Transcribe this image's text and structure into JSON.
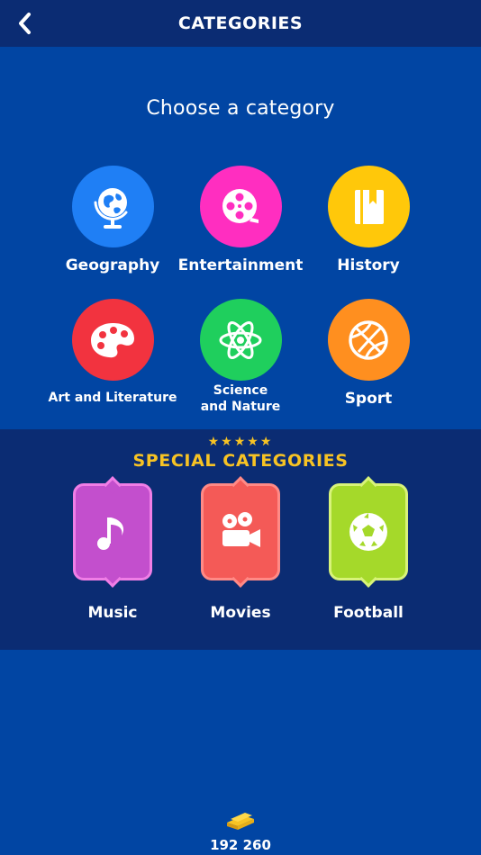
{
  "header": {
    "title": "CATEGORIES"
  },
  "subtitle": "Choose a category",
  "categories": [
    {
      "label": "Geography",
      "color": "#1f7ff5"
    },
    {
      "label": "Entertainment",
      "color": "#ff2ec0"
    },
    {
      "label": "History",
      "color": "#ffc80a"
    },
    {
      "label": "Art and Literature",
      "color": "#f2333f"
    },
    {
      "label": "Science",
      "label2": "and Nature",
      "color": "#1fcf5d"
    },
    {
      "label": "Sport",
      "color": "#ff8f1f"
    }
  ],
  "special": {
    "stars": "★★★★★",
    "title": "SPECIAL CATEGORIES",
    "items": [
      {
        "label": "Music",
        "fill": "#c34fcd",
        "border": "#f07ee6"
      },
      {
        "label": "Movies",
        "fill": "#f45a57",
        "border": "#ff8a86"
      },
      {
        "label": "Football",
        "fill": "#a5d92a",
        "border": "#d8f37a"
      }
    ]
  },
  "coins": {
    "count": "192 260"
  }
}
